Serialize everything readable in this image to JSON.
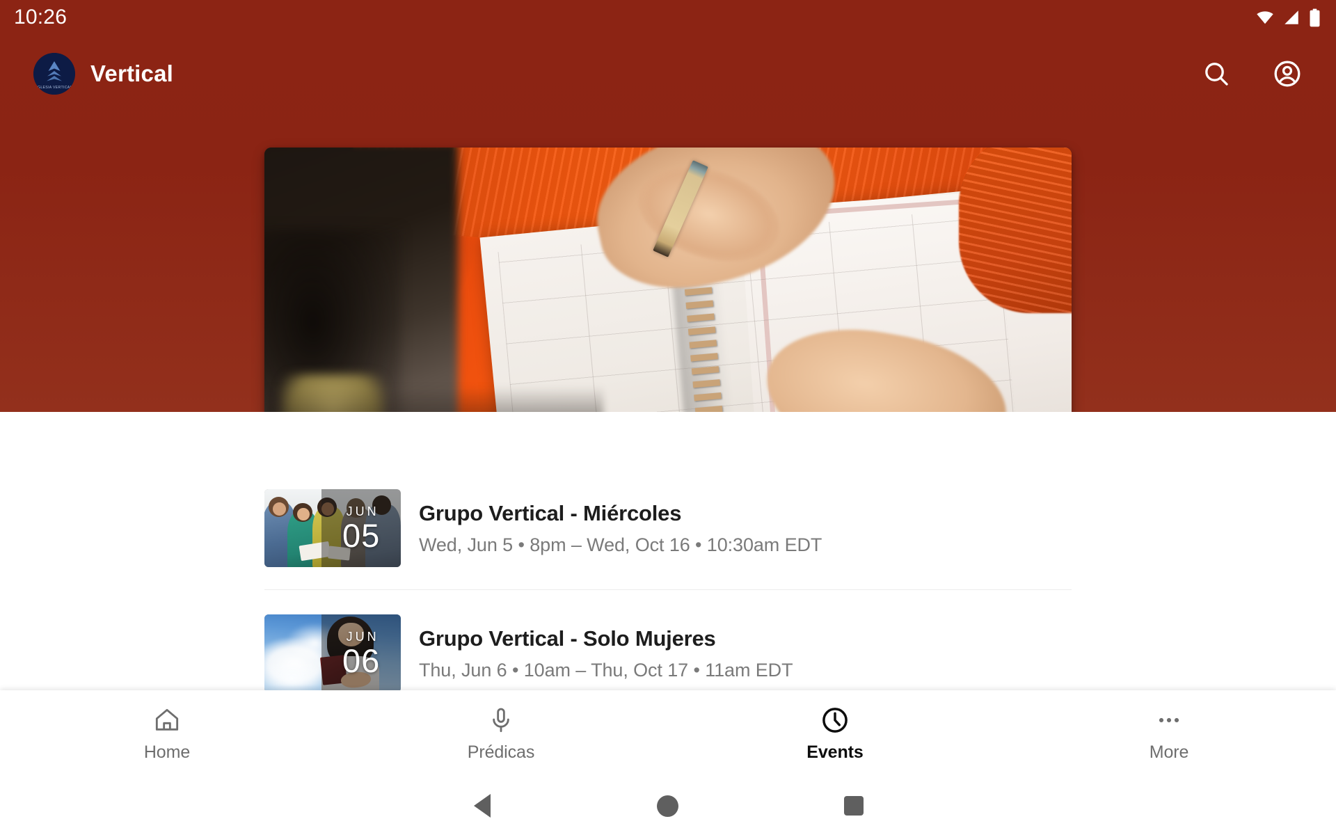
{
  "status_bar": {
    "clock": "10:26",
    "icons": [
      "wifi-icon",
      "cellular-signal-icon",
      "battery-icon"
    ]
  },
  "app_bar": {
    "brand_title": "Vertical",
    "logo_name": "vertical-church-logo",
    "logo_text": "IGLESIA VERTICAL",
    "actions": [
      {
        "name": "search-icon",
        "label": "Search"
      },
      {
        "name": "account-circle-icon",
        "label": "Account"
      }
    ]
  },
  "hero": {
    "name": "events-hero-banner",
    "alt": "Person writing in a spiral planner wearing an orange sweater"
  },
  "events": [
    {
      "title": "Grupo Vertical - Miércoles",
      "subtitle": "Wed, Jun 5 • 8pm – Wed, Oct 16 • 10:30am EDT",
      "month": "JUN",
      "day": "05",
      "thumb_name": "event-thumbnail-small-group"
    },
    {
      "title": "Grupo Vertical - Solo Mujeres",
      "subtitle": "Thu, Jun 6 • 10am – Thu, Oct 17 • 11am EDT",
      "month": "JUN",
      "day": "06",
      "thumb_name": "event-thumbnail-women-sky"
    }
  ],
  "bottom_nav": {
    "items": [
      {
        "label": "Home",
        "icon": "home-icon",
        "active": false
      },
      {
        "label": "Prédicas",
        "icon": "microphone-icon",
        "active": false
      },
      {
        "label": "Events",
        "icon": "clock-icon",
        "active": true
      },
      {
        "label": "More",
        "icon": "more-horizontal-icon",
        "active": false
      }
    ]
  },
  "system_nav": {
    "back": "back-button",
    "home": "home-button",
    "recents": "recents-button"
  },
  "colors": {
    "brand_red": "#8b2414",
    "logo_navy": "#0d1b45",
    "nav_active": "#0d0d0d",
    "nav_inactive": "#6e6e6e",
    "title_text": "#1d1d1d",
    "subtitle_text": "#7a7a7a"
  }
}
